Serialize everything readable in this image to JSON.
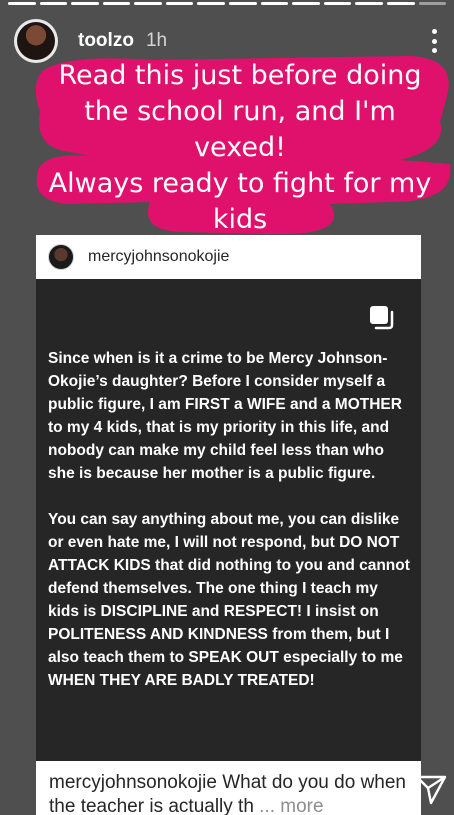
{
  "story": {
    "progress": {
      "segments_total": 14,
      "segments_viewed": 13
    },
    "username": "toolzo",
    "time": "1h",
    "caption_lines": [
      "Read this just before doing",
      "the school run, and I'm",
      "vexed!",
      "Always ready to fight for my",
      "kids"
    ],
    "highlight_color": "#e0116c"
  },
  "post": {
    "username": "mercyjohnsonokojie",
    "paragraph_1": "Since when is it a crime to be Mercy Johnson-Okojie’s daughter? Before I consider myself a public figure, I am FIRST a WIFE and a MOTHER to my 4 kids, that is my priority in this life, and nobody can make my child feel less than who she is because her mother is a public figure.",
    "paragraph_2": "You can say anything about me, you can dislike or even hate me, I will not respond, but DO NOT ATTACK KIDS that did nothing to you and cannot defend themselves. The one thing I teach my kids is DISCIPLINE and RESPECT! I insist on POLITENESS AND KINDNESS from them, but I also teach them to SPEAK OUT especially to me WHEN THEY ARE BADLY TREATED!",
    "caption_user": "mercyjohnsonokojie",
    "caption_text": "What do you do when the teacher is actually th",
    "caption_more": "... more"
  },
  "icons": {
    "more": "vertical-ellipsis",
    "copy": "multiple-images",
    "send": "paper-plane"
  }
}
